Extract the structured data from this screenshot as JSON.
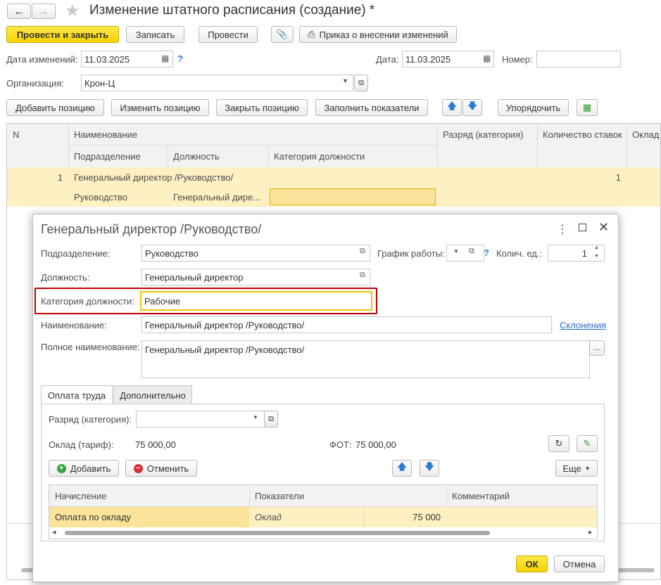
{
  "window": {
    "title": "Изменение штатного расписания (создание) *"
  },
  "toolbar": {
    "post_close": "Провести и закрыть",
    "save": "Записать",
    "post": "Провести",
    "order": "Приказ о внесении изменений"
  },
  "header": {
    "change_date_label": "Дата изменений:",
    "change_date_value": "11.03.2025",
    "date_label": "Дата:",
    "date_value": "11.03.2025",
    "number_label": "Номер:",
    "number_value": "",
    "org_label": "Организация:",
    "org_value": "Крон-Ц"
  },
  "actions": {
    "add_position": "Добавить позицию",
    "change_position": "Изменить позицию",
    "close_position": "Закрыть позицию",
    "fill_indicators": "Заполнить показатели",
    "sort": "Упорядочить"
  },
  "grid": {
    "col_n": "N",
    "col_name": "Наименование",
    "col_grade": "Разряд (категория)",
    "col_rates": "Количество ставок",
    "col_salary": "Оклад",
    "sub_department": "Подразделение",
    "sub_position": "Должность",
    "sub_category": "Категория должности",
    "rows": [
      {
        "n": "1",
        "name": "Генеральный директор /Руководство/",
        "department": "Руководство",
        "position": "Генеральный дире...",
        "category": "",
        "rates": "1"
      }
    ]
  },
  "dialog": {
    "title": "Генеральный директор /Руководство/",
    "department_label": "Подразделение:",
    "department_value": "Руководство",
    "schedule_label": "График работы:",
    "schedule_value": "",
    "units_label": "Колич. ед.:",
    "units_value": "1",
    "position_label": "Должность:",
    "position_value": "Генеральный директор",
    "category_label": "Категория должности:",
    "category_value": "Рабочие",
    "name_label": "Наименование:",
    "name_value": "Генеральный директор /Руководство/",
    "declensions_link": "Склонения",
    "full_name_label": "Полное наименование:",
    "full_name_value": "Генеральный директор /Руководство/",
    "tabs": [
      "Оплата труда",
      "Дополнительно"
    ],
    "grade_label": "Разряд (категория):",
    "grade_value": "",
    "salary_label": "Оклад (тариф):",
    "salary_value": "75 000,00",
    "fot_label": "ФОТ:",
    "fot_value": "75 000,00",
    "add_button": "Добавить",
    "cancel_button": "Отменить",
    "more_button": "Еще",
    "table": {
      "col_accrual": "Начисление",
      "col_indicators": "Показатели",
      "col_comment": "Комментарий",
      "rows": [
        {
          "accrual": "Оплата по окладу",
          "indicator": "Оклад",
          "amount": "75 000",
          "comment": ""
        }
      ]
    },
    "ok": "ОК",
    "cancel": "Отмена"
  },
  "colors": {
    "primary_button": "#f5d200",
    "selected_row": "#fdf0c2",
    "highlight_border": "#c00000",
    "link": "#2a6fc9"
  }
}
